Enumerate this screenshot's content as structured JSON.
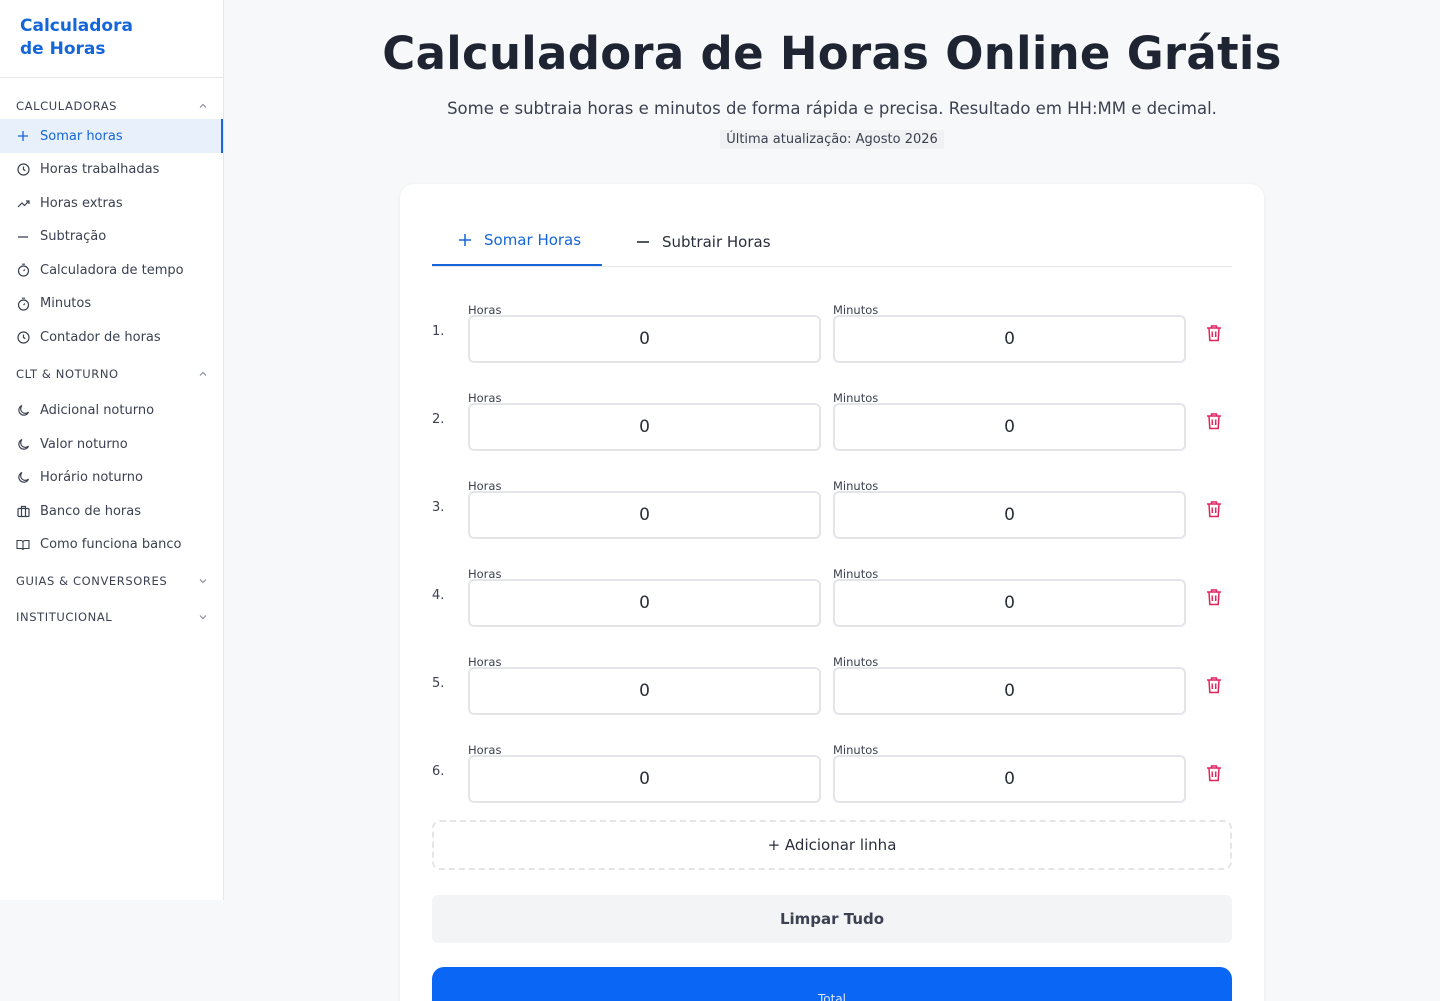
{
  "brand": {
    "line1": "Calculadora",
    "line2": "de Horas"
  },
  "sidebar": {
    "sections": [
      {
        "title": "CALCULADORAS",
        "expanded": true,
        "items": [
          {
            "label": "Somar horas",
            "icon": "plus-icon",
            "active": true
          },
          {
            "label": "Horas trabalhadas",
            "icon": "clock-icon"
          },
          {
            "label": "Horas extras",
            "icon": "trending-up-icon"
          },
          {
            "label": "Subtração",
            "icon": "minus-icon"
          },
          {
            "label": "Calculadora de tempo",
            "icon": "stopwatch-icon"
          },
          {
            "label": "Minutos",
            "icon": "stopwatch-icon"
          },
          {
            "label": "Contador de horas",
            "icon": "clock-icon"
          }
        ]
      },
      {
        "title": "CLT & NOTURNO",
        "expanded": true,
        "items": [
          {
            "label": "Adicional noturno",
            "icon": "moon-icon"
          },
          {
            "label": "Valor noturno",
            "icon": "moon-icon"
          },
          {
            "label": "Horário noturno",
            "icon": "moon-icon"
          },
          {
            "label": "Banco de horas",
            "icon": "briefcase-icon"
          },
          {
            "label": "Como funciona banco",
            "icon": "book-icon"
          }
        ]
      },
      {
        "title": "GUIAS & CONVERSORES",
        "expanded": false,
        "items": []
      },
      {
        "title": "INSTITUCIONAL",
        "expanded": false,
        "items": []
      }
    ]
  },
  "header": {
    "title": "Calculadora de Horas Online Grátis",
    "subtitle": "Some e subtraia horas e minutos de forma rápida e precisa. Resultado em HH:MM e decimal.",
    "updated": "Última atualização: Agosto 2026"
  },
  "calculator": {
    "tabs": [
      {
        "label": "Somar Horas",
        "icon": "plus-icon",
        "active": true
      },
      {
        "label": "Subtrair Horas",
        "icon": "minus-icon",
        "active": false
      }
    ],
    "hours_label": "Horas",
    "minutes_label": "Minutos",
    "rows": [
      {
        "num": "1.",
        "hours": "0",
        "minutes": "0"
      },
      {
        "num": "2.",
        "hours": "0",
        "minutes": "0"
      },
      {
        "num": "3.",
        "hours": "0",
        "minutes": "0"
      },
      {
        "num": "4.",
        "hours": "0",
        "minutes": "0"
      },
      {
        "num": "5.",
        "hours": "0",
        "minutes": "0"
      },
      {
        "num": "6.",
        "hours": "0",
        "minutes": "0"
      }
    ],
    "add_line_label": "+ Adicionar linha",
    "clear_label": "Limpar Tudo",
    "total_label": "Total"
  },
  "colors": {
    "accent": "#1466d9",
    "total_bg": "#0a66f5",
    "delete": "#e0245e"
  }
}
